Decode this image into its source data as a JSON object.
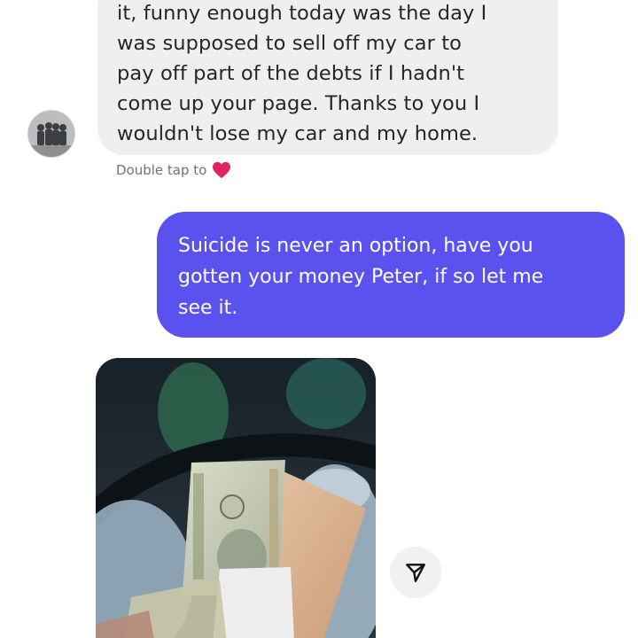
{
  "conversation": {
    "incoming_message": {
      "lines": [
        "it, funny enough today was the day I",
        "was supposed to sell off my car to",
        "pay off part of the debts if I hadn't",
        "come up your page. Thanks to you I",
        "wouldn't lose my car and my home."
      ]
    },
    "like_hint": {
      "text": "Double tap to",
      "icon": "heart-icon",
      "icon_color": "#e0245e"
    },
    "outgoing_message": {
      "lines": [
        "Suicide is never an option, have you",
        "gotten your money Peter, if so let me",
        "see it."
      ],
      "bubble_color": "#5b51ee"
    },
    "photo_message": {
      "share_icon": "send-icon"
    }
  }
}
